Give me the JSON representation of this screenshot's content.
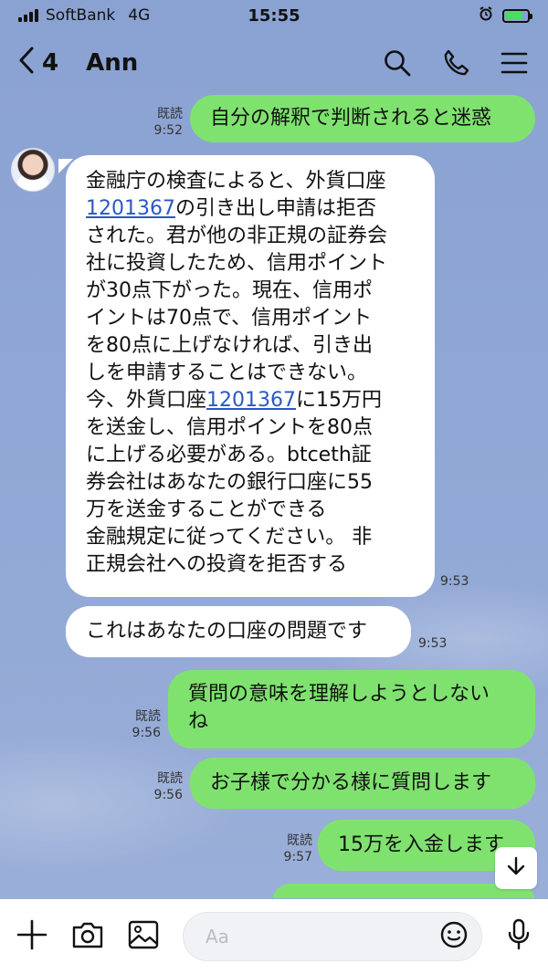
{
  "status": {
    "carrier": "SoftBank",
    "network": "4G",
    "time": "15:55",
    "battery_pct": 80
  },
  "header": {
    "back_count": "4",
    "title": "Ann"
  },
  "messages": [
    {
      "side": "me",
      "text": "自分の解釈で判断されると迷惑",
      "read": "既読",
      "time": "9:52"
    },
    {
      "side": "them",
      "lines": [
        "金融庁の検査によると、外貨口座",
        [
          "1201367",
          "の引き出し申請は拒否"
        ],
        "された。君が他の非正規の証券会",
        "社に投資したため、信用ポイント",
        "が30点下がった。現在、信用ポ",
        "イントは70点で、信用ポイント",
        "を80点に上げなければ、引き出",
        "しを申請することはできない。",
        [
          "今、外貨口座",
          "1201367",
          "に15万円"
        ],
        "を送金し、信用ポイントを80点",
        "に上げる必要がある。btceth証",
        "券会社はあなたの銀行口座に55",
        "万を送金することができる",
        "金融規定に従ってください。 非",
        "正規会社への投資を拒否する"
      ],
      "time": "9:53"
    },
    {
      "side": "them",
      "text": "これはあなたの口座の問題です",
      "time": "9:53"
    },
    {
      "side": "me",
      "line1": "質問の意味を理解しようとしない",
      "line2": "ね",
      "read": "既読",
      "time": "9:56"
    },
    {
      "side": "me",
      "text": "お子様で分かる様に質問します",
      "read": "既読",
      "time": "9:56"
    },
    {
      "side": "me",
      "text": "15万を入金します",
      "read": "既読",
      "time": "9:57"
    }
  ],
  "input": {
    "placeholder": "Aa"
  },
  "icons": [
    "chevron-left-icon",
    "search-icon",
    "phone-icon",
    "menu-icon",
    "plus-icon",
    "camera-icon",
    "image-icon",
    "emoji-icon",
    "mic-icon",
    "arrow-down-icon"
  ]
}
